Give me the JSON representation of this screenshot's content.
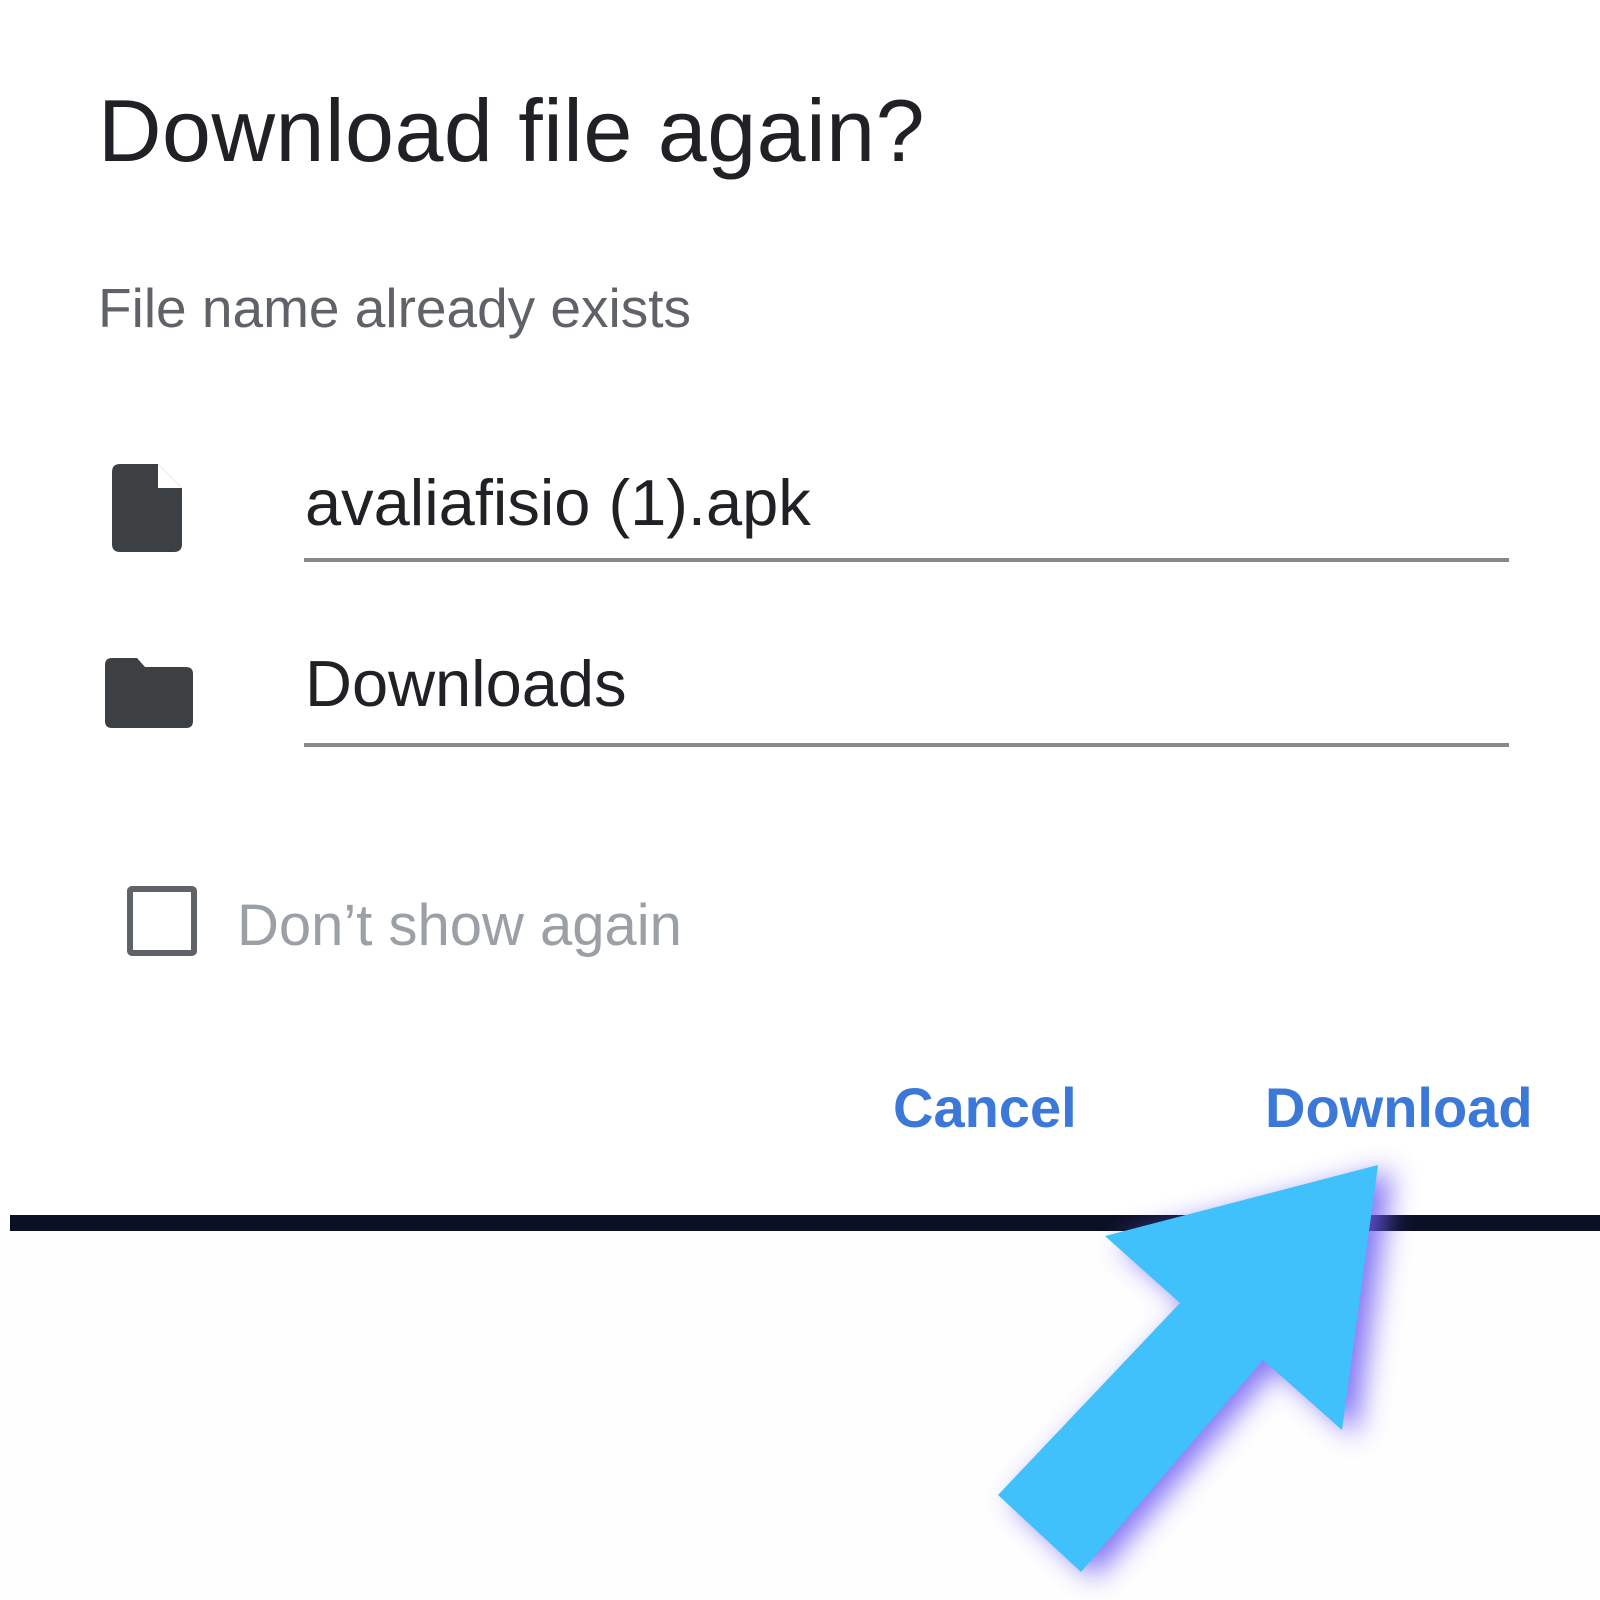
{
  "dialog": {
    "title": "Download file again?",
    "subtitle": "File name already exists",
    "file_name": "avaliafisio (1).apk",
    "folder": "Downloads",
    "checkbox_label": "Don’t show again",
    "checkbox_checked": false,
    "cancel_label": "Cancel",
    "download_label": "Download"
  },
  "icons": {
    "file": "file-icon",
    "folder": "folder-icon",
    "pointer_arrow": "pointer-arrow-icon"
  },
  "colors": {
    "button_text": "#3b78d8",
    "arrow": "#40c1fb",
    "divider": "#0b1024"
  }
}
